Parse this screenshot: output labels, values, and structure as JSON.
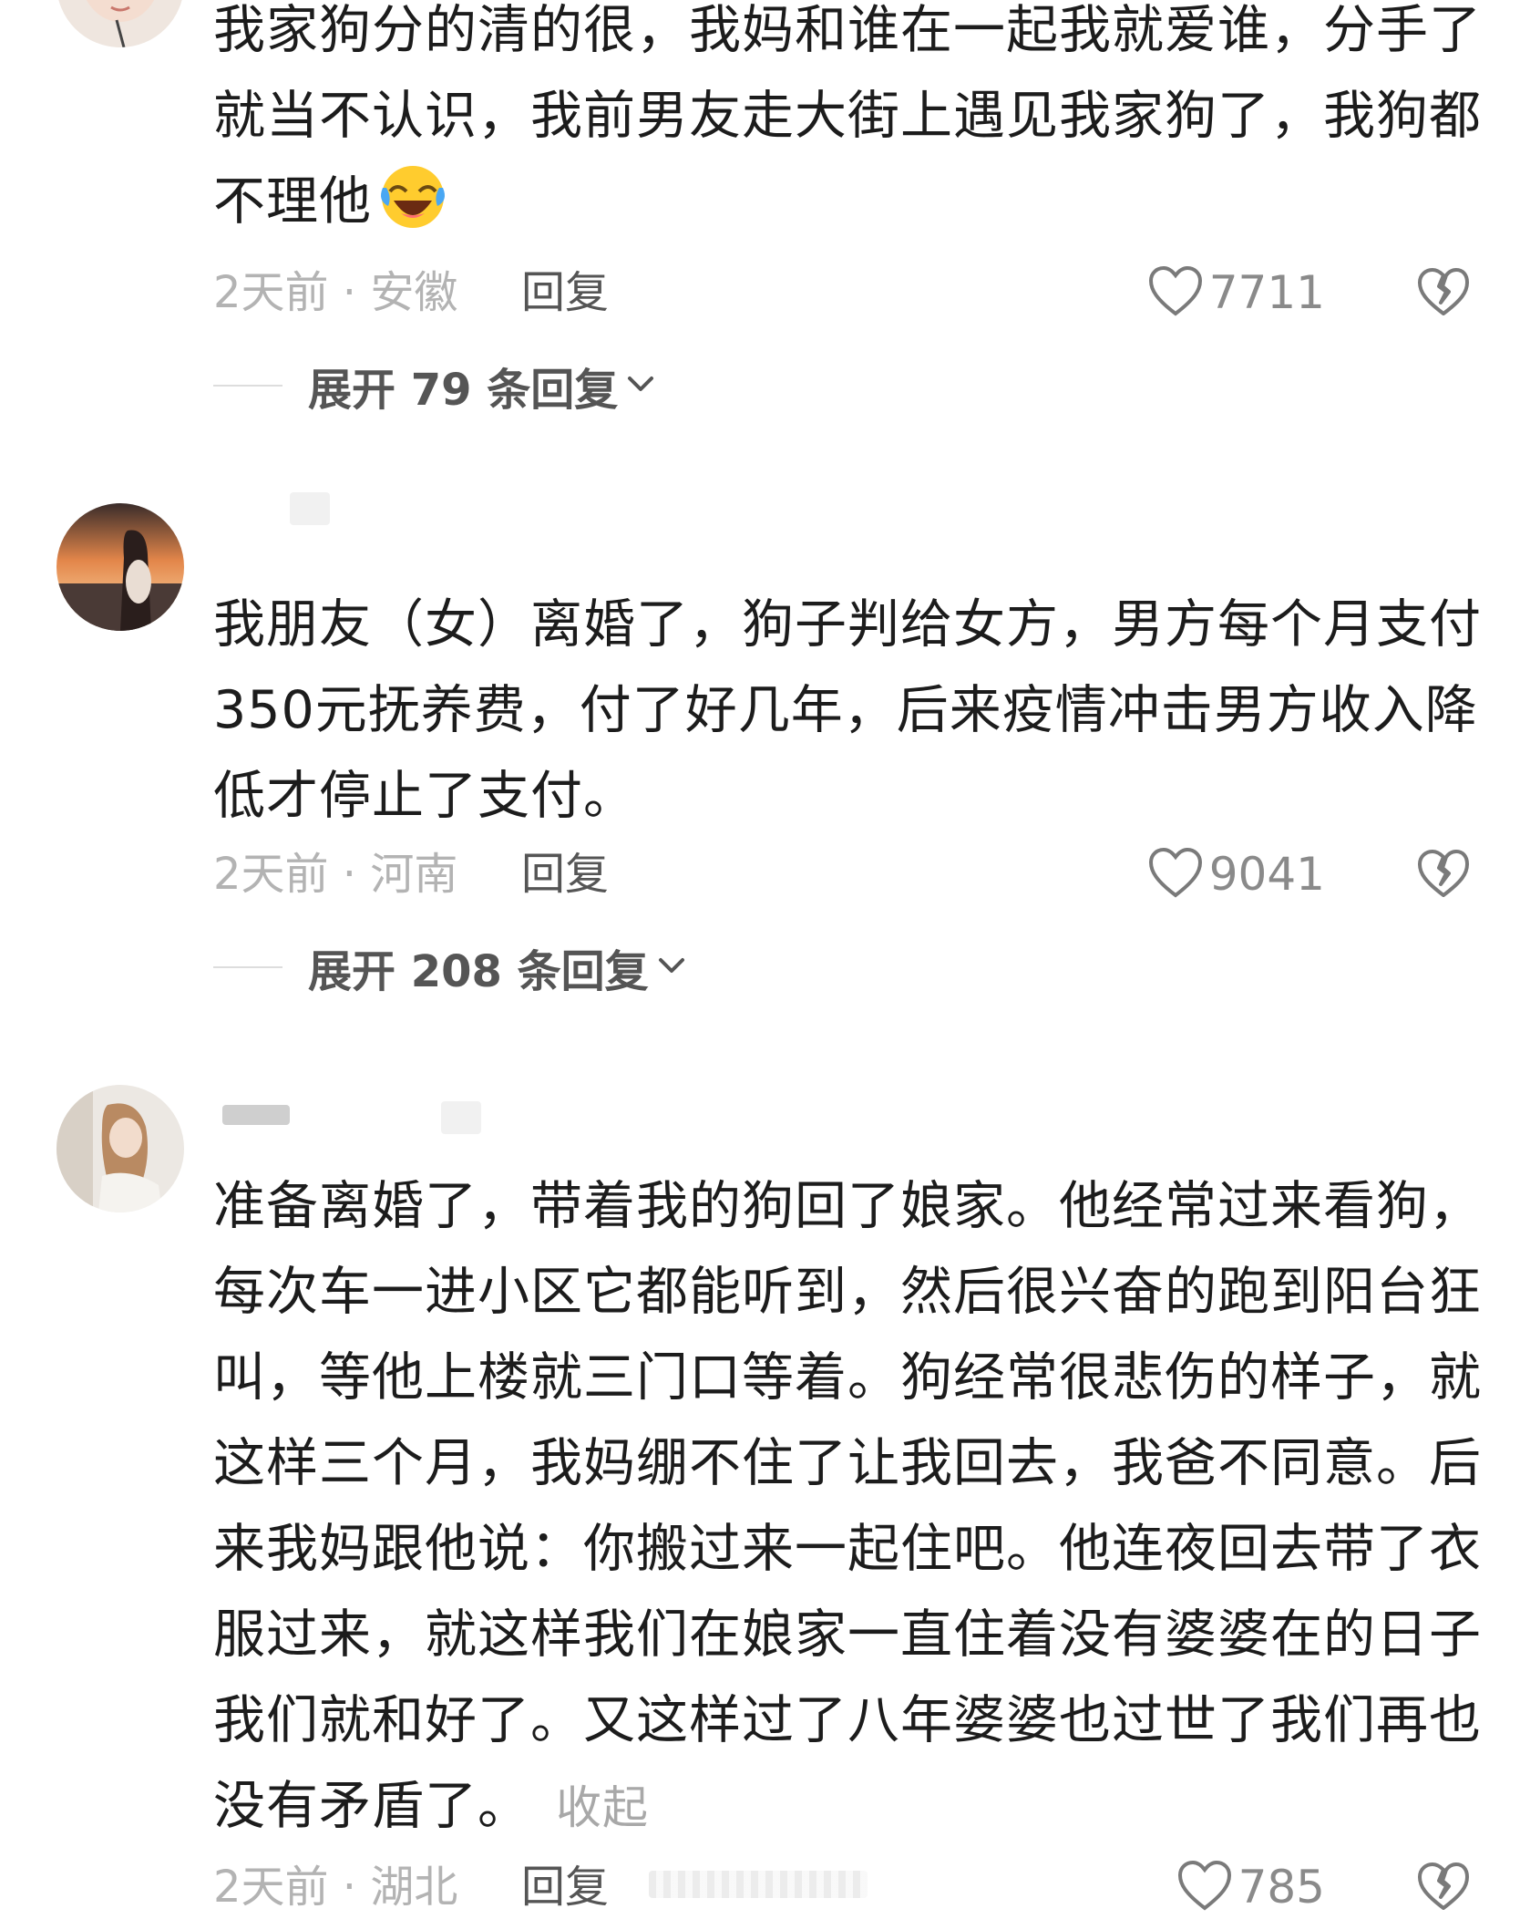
{
  "comments": [
    {
      "username": "",
      "body_lines": [
        "我家狗分的清的很，我妈和谁在一起我就爱谁，分手了",
        "就当不认识，我前男友走大街上遇见我家狗了，我狗都",
        "不理他"
      ],
      "emoji": "laughing-crying-emoji",
      "meta": "2天前 · 安徽",
      "reply_label": "回复",
      "likes": "7711",
      "expand_label": "展开 79 条回复"
    },
    {
      "username": "",
      "body_lines": [
        "我朋友（女）离婚了，狗子判给女方，男方每个月支付",
        "350元抚养费，付了好几年，后来疫情冲击男方收入降",
        "低才停止了支付。"
      ],
      "meta": "2天前 · 河南",
      "reply_label": "回复",
      "likes": "9041",
      "expand_label": "展开 208 条回复"
    },
    {
      "username": "",
      "body_lines": [
        "准备离婚了，带着我的狗回了娘家。他经常过来看狗，",
        "每次车一进小区它都能听到，然后很兴奋的跑到阳台狂",
        "叫，等他上楼就三门口等着。狗经常很悲伤的样子，就",
        "这样三个月，我妈绷不住了让我回去，我爸不同意。后",
        "来我妈跟他说：你搬过来一起住吧。他连夜回去带了衣",
        "服过来，就这样我们在娘家一直住着没有婆婆在的日子",
        "我们就和好了。又这样过了八年婆婆也过世了我们再也",
        "没有矛盾了。"
      ],
      "collapse_label": "收起",
      "meta": "2天前 · 湖北",
      "reply_label": "回复",
      "likes": "785"
    }
  ],
  "icons": {
    "like": "heart-outline-icon",
    "dislike": "broken-heart-icon",
    "expand": "chevron-down-icon"
  },
  "colors": {
    "text": "#1c1c1c",
    "meta": "#b3b3b3",
    "secondary": "#555555",
    "background": "#ffffff"
  }
}
